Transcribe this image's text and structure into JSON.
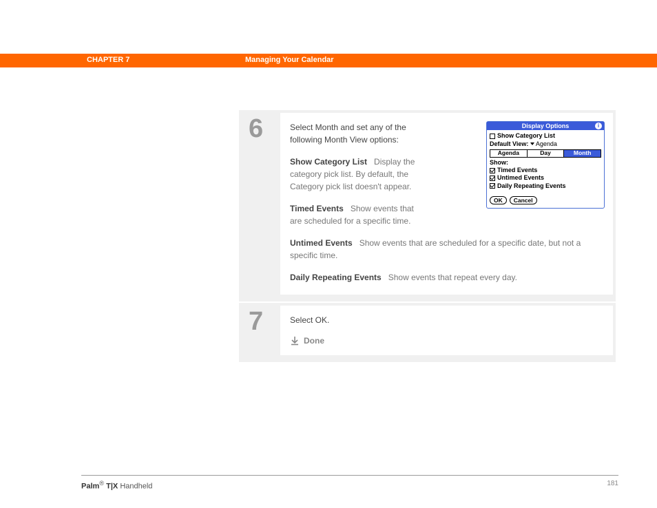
{
  "header": {
    "chapter_label": "CHAPTER 7",
    "chapter_title": "Managing Your Calendar"
  },
  "steps": {
    "s6": {
      "number": "6",
      "intro": "Select Month and set any of the following Month View options:",
      "options": [
        {
          "label": "Show Category List",
          "desc": "Display the category pick list. By default, the Category pick list doesn't appear."
        },
        {
          "label": "Timed Events",
          "desc": "Show events that are scheduled for a specific time."
        },
        {
          "label": "Untimed Events",
          "desc": "Show events that are scheduled for a specific date, but not a specific time."
        },
        {
          "label": "Daily Repeating Events",
          "desc": "Show events that repeat every day."
        }
      ]
    },
    "s7": {
      "number": "7",
      "intro": "Select OK.",
      "done_label": "Done"
    }
  },
  "palm_dialog": {
    "title": "Display Options",
    "show_category_list": "Show Category List",
    "default_view_label": "Default View:",
    "default_view_value": "Agenda",
    "tabs": [
      "Agenda",
      "Day",
      "Month"
    ],
    "selected_tab": 2,
    "show_label": "Show:",
    "checkboxes": [
      {
        "label": "Timed Events",
        "checked": true
      },
      {
        "label": "Untimed Events",
        "checked": true
      },
      {
        "label": "Daily Repeating Events",
        "checked": true
      }
    ],
    "ok_label": "OK",
    "cancel_label": "Cancel"
  },
  "footer": {
    "product_a": "Palm",
    "product_b": "T|X",
    "product_c": "Handheld",
    "page": "181"
  }
}
